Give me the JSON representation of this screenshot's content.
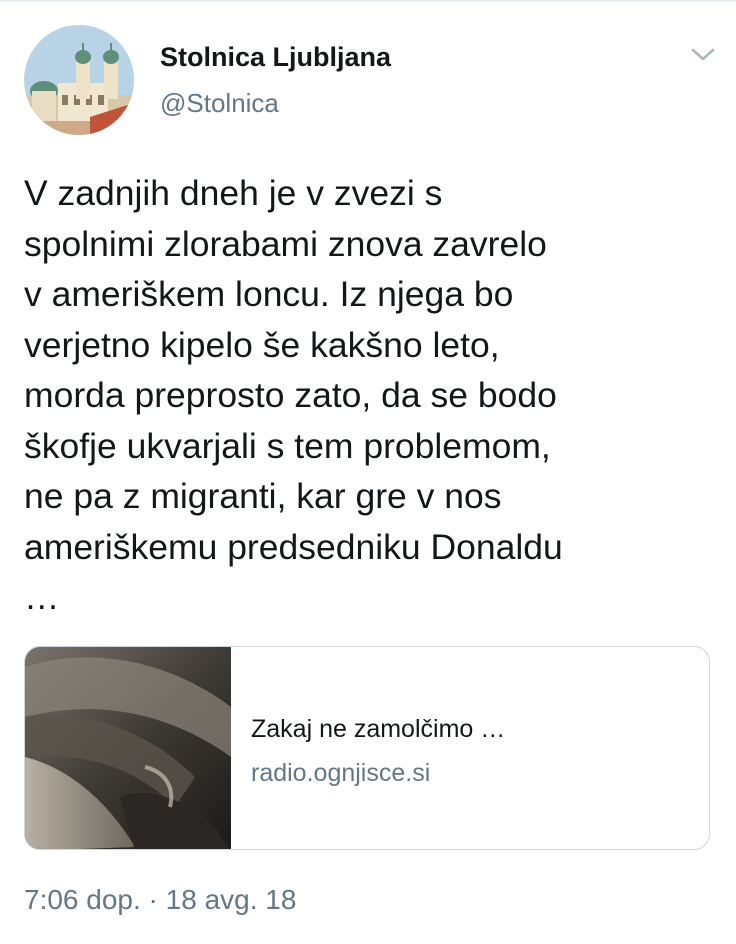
{
  "author": {
    "name": "Stolnica Ljubljana",
    "handle": "@Stolnica"
  },
  "tweet": {
    "text": "V zadnjih dneh je v zvezi s\nspolnimi zlorabami znova zavrelo\nv ameriškem loncu. Iz njega bo\nverjetno kipelo še kakšno leto,\nmorda preprosto zato, da se bodo\nškofje ukvarjali s tem problemom,\nne pa z migranti, kar gre v nos\nameriškemu predsedniku Donaldu\n…"
  },
  "link_card": {
    "title": "Zakaj ne zamolčimo …",
    "domain": "radio.ognjisce.si"
  },
  "meta": {
    "time": "7:06 dop.",
    "separator": " · ",
    "date": "18 avg. 18"
  },
  "icons": {
    "menu": "chevron-down-icon"
  },
  "colors": {
    "text_primary": "#14171a",
    "text_secondary": "#657786",
    "border": "#ccd6dd"
  }
}
